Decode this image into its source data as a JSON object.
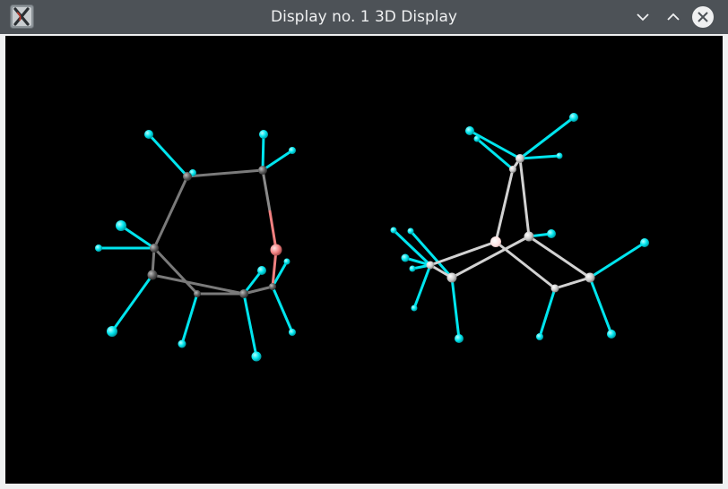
{
  "window": {
    "title": "Display no. 1 3D Display",
    "app_icon": "xwindows-app-icon",
    "controls": [
      "minimize-icon",
      "maximize-icon",
      "close-icon"
    ]
  },
  "viewport": {
    "background": "#000000"
  },
  "colors": {
    "titlebar": "#4d5257",
    "title_text": "#eff0f1",
    "carbon": "#5a5a5a",
    "hydrogen": "#00e5ee",
    "oxygen_left": "#f08080",
    "light_atom": "#c8c8c8",
    "center_atom": "#ffe0e0"
  }
}
